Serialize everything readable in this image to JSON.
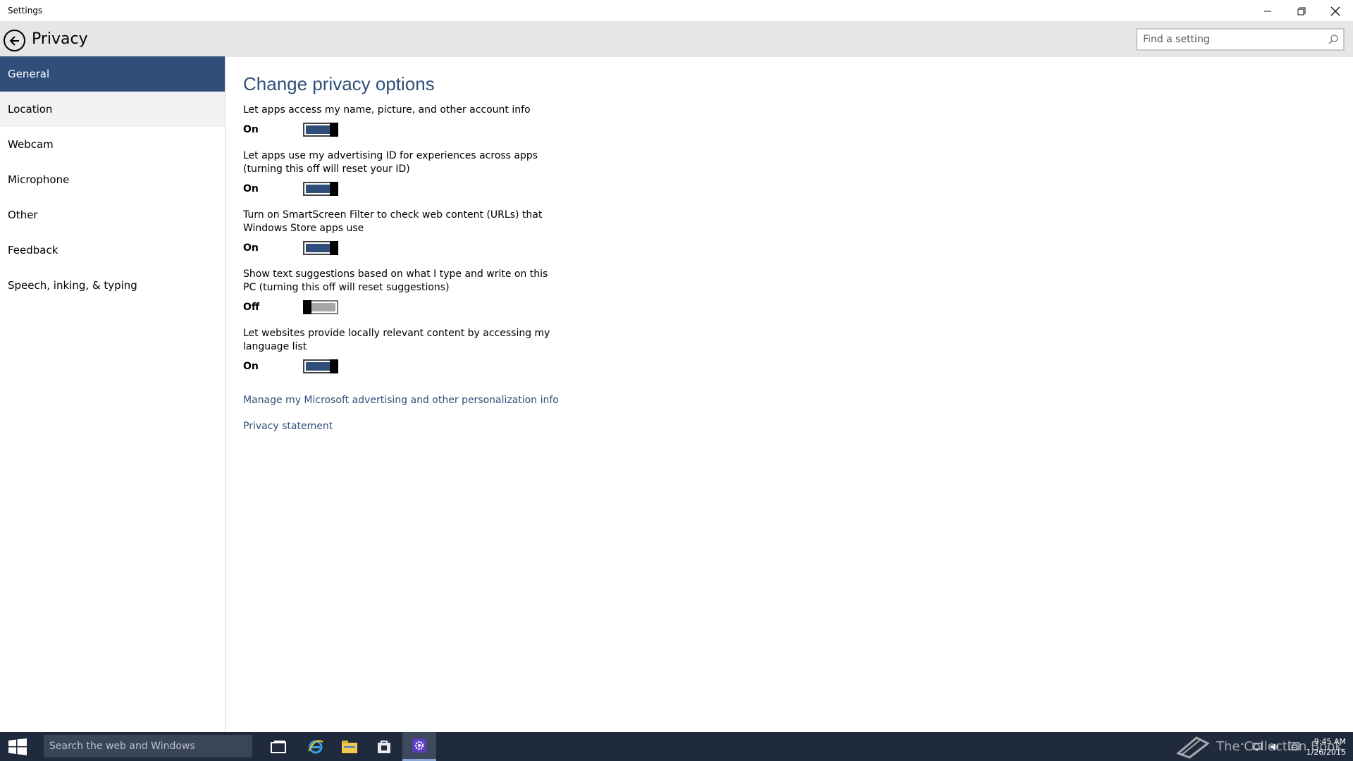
{
  "window": {
    "title": "Settings",
    "minimize_icon": "minimize-icon",
    "restore_icon": "restore-icon",
    "close_icon": "close-icon"
  },
  "header": {
    "title": "Privacy",
    "back_icon": "back-arrow-icon",
    "search_placeholder": "Find a setting",
    "search_value": "",
    "search_icon": "magnifier-icon"
  },
  "sidebar": {
    "items": [
      {
        "label": "General",
        "state": "selected"
      },
      {
        "label": "Location",
        "state": "hover"
      },
      {
        "label": "Webcam",
        "state": "normal"
      },
      {
        "label": "Microphone",
        "state": "normal"
      },
      {
        "label": "Other",
        "state": "normal"
      },
      {
        "label": "Feedback",
        "state": "normal"
      },
      {
        "label": "Speech, inking, & typing",
        "state": "normal"
      }
    ]
  },
  "main": {
    "heading": "Change privacy options",
    "settings": [
      {
        "description": "Let apps access my name, picture, and other account info",
        "state_label": "On",
        "on": true
      },
      {
        "description": "Let apps use my advertising ID for experiences across apps (turning this off will reset your ID)",
        "state_label": "On",
        "on": true
      },
      {
        "description": "Turn on SmartScreen Filter to check web content (URLs) that Windows Store apps use",
        "state_label": "On",
        "on": true
      },
      {
        "description": "Show text suggestions based on what I type and write on this PC (turning this off will reset suggestions)",
        "state_label": "Off",
        "on": false
      },
      {
        "description": "Let websites provide locally relevant content by accessing my language list",
        "state_label": "On",
        "on": true
      }
    ],
    "links": {
      "manage_ads": "Manage my Microsoft advertising and other personalization info",
      "privacy_statement": "Privacy statement"
    }
  },
  "taskbar": {
    "search_placeholder": "Search the web and Windows",
    "apps": [
      "task-view-icon",
      "internet-explorer-icon",
      "file-explorer-icon",
      "store-icon",
      "settings-gear-icon"
    ],
    "active_app": "settings-gear-icon",
    "clock_time": "9:45 AM",
    "clock_date": "1/26/2015"
  },
  "watermark": {
    "text": "The Collection Book"
  },
  "colors": {
    "accent": "#2f4f7a",
    "header_bg": "#e6e6e6",
    "taskbar_bg": "#1f2b3d",
    "toggle_off": "#a6a6a6"
  }
}
